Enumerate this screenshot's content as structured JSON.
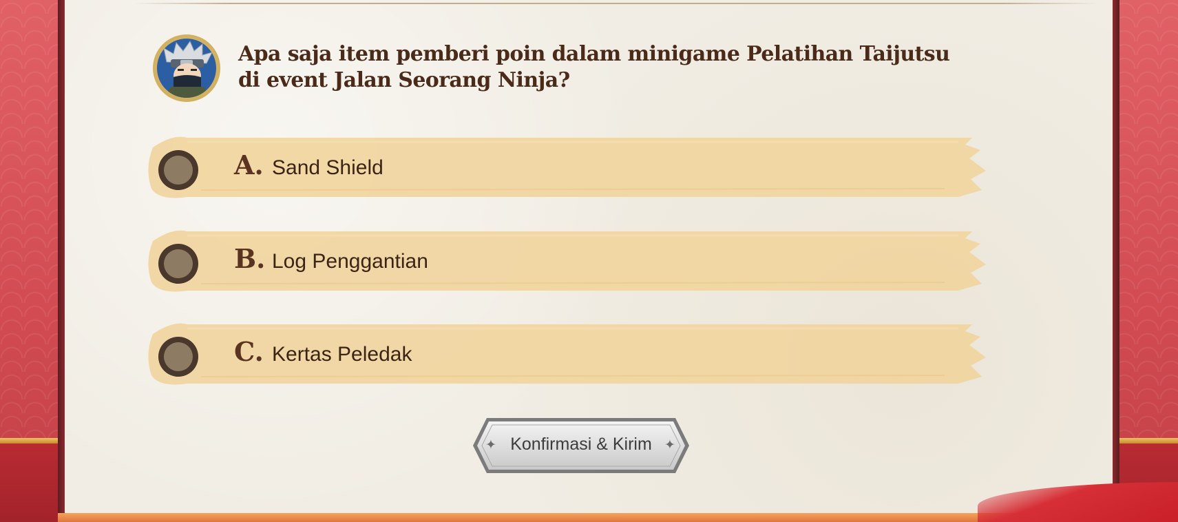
{
  "quiz": {
    "question": "Apa saja item pemberi poin dalam minigame Pelatihan Taijutsu di event Jalan Seorang Ninja?",
    "avatar_icon": "ninja-character-icon",
    "options": [
      {
        "letter": "A.",
        "text": "Sand Shield"
      },
      {
        "letter": "B.",
        "text": "Log Penggantian"
      },
      {
        "letter": "C.",
        "text": "Kertas Peledak"
      }
    ],
    "confirm_label": "Konfirmasi & Kirim"
  },
  "colors": {
    "paper": "#f1ede4",
    "brush": "#f0d59e",
    "text_dark": "#4a2a18",
    "side_red": "#d24b52",
    "gold": "#e2aa4b"
  }
}
